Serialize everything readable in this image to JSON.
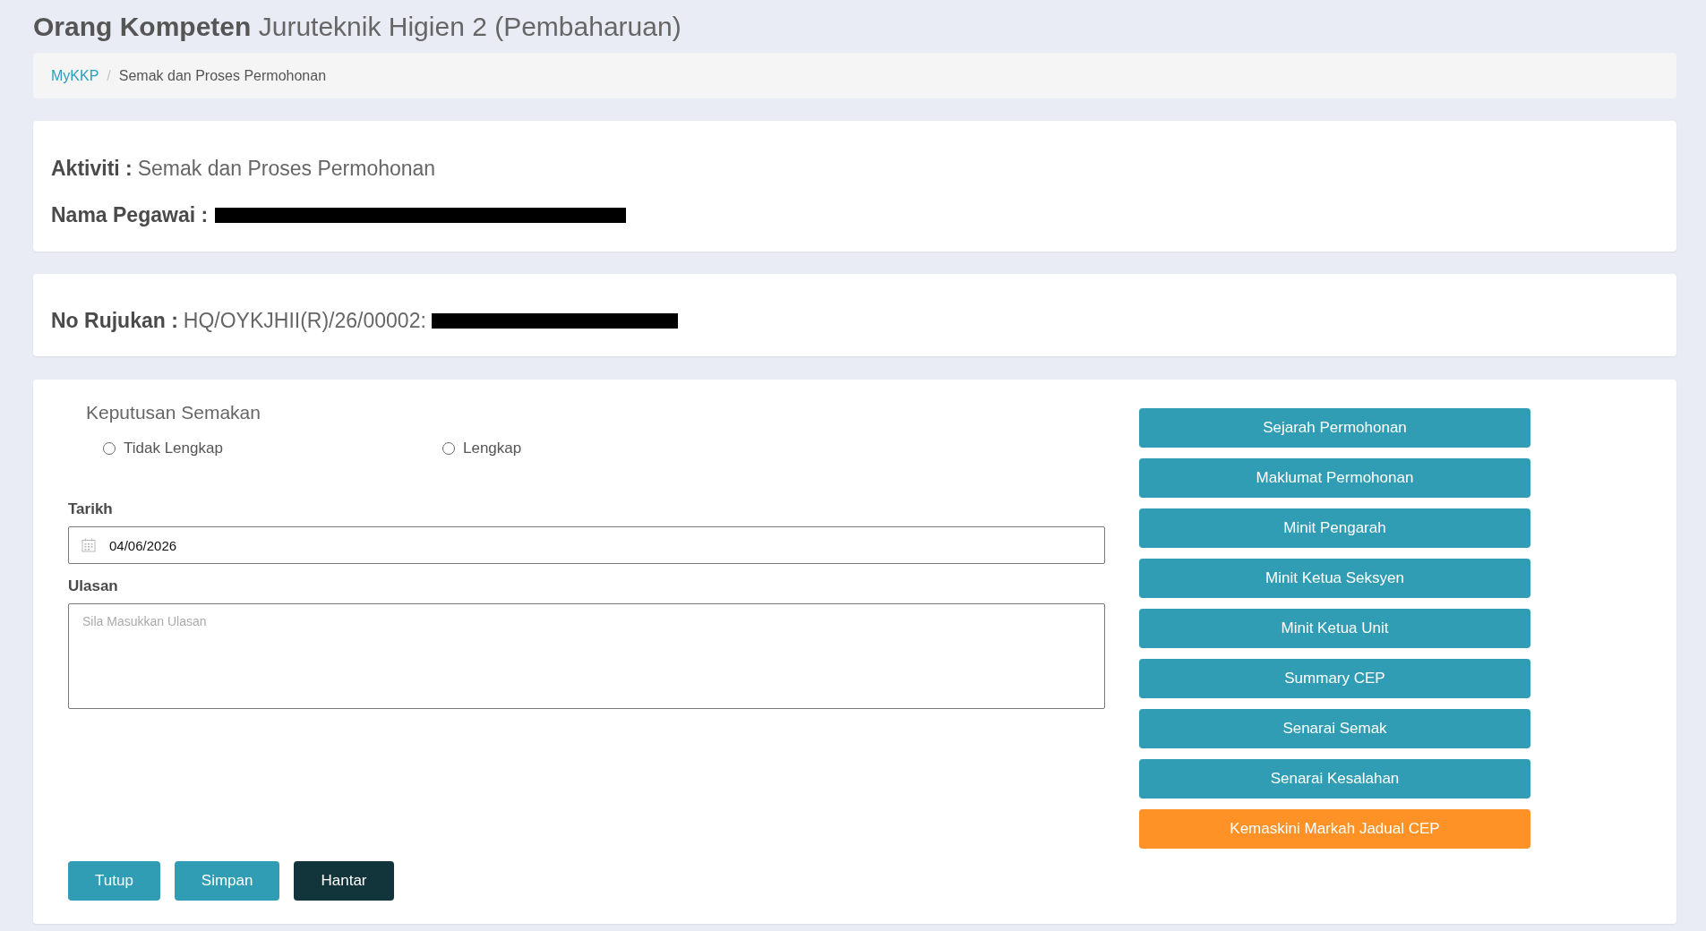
{
  "page_title": {
    "bold": "Orang Kompeten",
    "rest": "Juruteknik Higien 2 (Pembaharuan)"
  },
  "breadcrumb": {
    "separator": "/",
    "items": [
      {
        "label": "MyKKP",
        "kind": "link"
      },
      {
        "label": "Semak dan Proses Permohonan",
        "kind": "current"
      }
    ]
  },
  "cards": [
    {
      "fields": [
        {
          "label": "Aktiviti :",
          "value": "Semak dan Proses Permohonan"
        },
        {
          "label": "Nama Pegawai :",
          "redacted": true
        }
      ]
    },
    {
      "fields": [
        {
          "label": "No Rujukan :",
          "value": "HQ/OYKJHII(R)/26/00002:",
          "redacted": true
        }
      ]
    }
  ],
  "review": {
    "title": "Keputusan Semakan",
    "options": [
      {
        "label": "Tidak Lengkap",
        "selected": false
      },
      {
        "label": "Lengkap",
        "selected": false
      }
    ],
    "date": {
      "label": "Tarikh",
      "value": "04/06/2026"
    },
    "remarks": {
      "label": "Ulasan",
      "placeholder": "Sila Masukkan Ulasan"
    }
  },
  "side_buttons": [
    {
      "label": "Sejarah Permohonan",
      "kind": "primary"
    },
    {
      "label": "Maklumat Permohonan",
      "kind": "primary"
    },
    {
      "label": "Minit Pengarah",
      "kind": "primary"
    },
    {
      "label": "Minit Ketua Seksyen",
      "kind": "primary"
    },
    {
      "label": "Minit Ketua Unit",
      "kind": "primary"
    },
    {
      "label": "Summary CEP",
      "kind": "primary"
    },
    {
      "label": "Senarai Semak",
      "kind": "primary"
    },
    {
      "label": "Senarai Kesalahan",
      "kind": "primary"
    },
    {
      "label": "Kemaskini Markah Jadual CEP",
      "kind": "warning"
    }
  ],
  "actions": [
    {
      "label": "Tutup",
      "kind": "primary"
    },
    {
      "label": "Simpan",
      "kind": "primary"
    },
    {
      "label": "Hantar",
      "kind": "dark"
    }
  ]
}
